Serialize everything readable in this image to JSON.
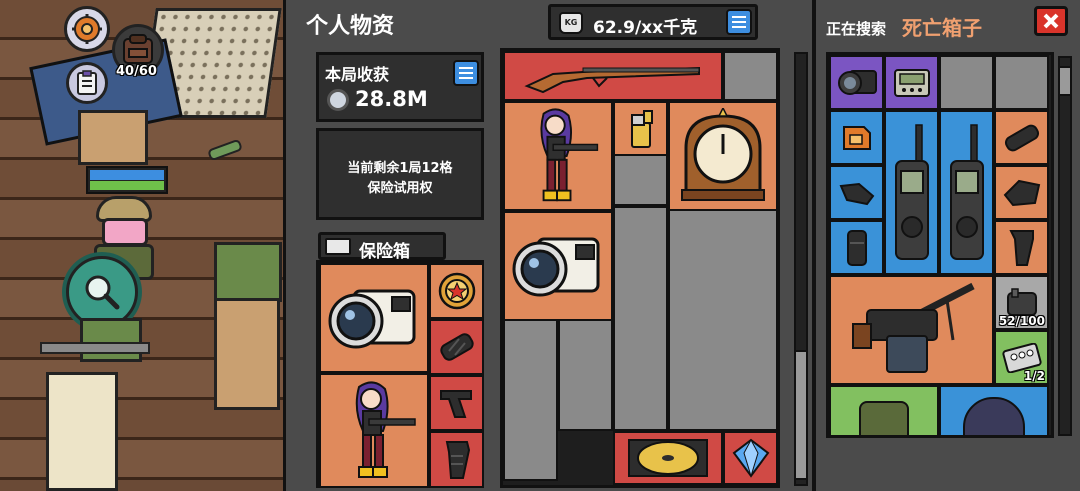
{
  "hud": {
    "carry_text": "40/60"
  },
  "personal": {
    "title": "个人物资",
    "weight_text": "62.9/xx千克",
    "kg_label": "KG",
    "earnings_title": "本局收获",
    "earnings_value": "28.8M",
    "insurance_note_line1": "当前剩余1局12格",
    "insurance_note_line2": "保险试用权",
    "safebox_title": "保险箱"
  },
  "search": {
    "label": "正在搜索",
    "target": "死亡箱子",
    "count_1": "52/100",
    "count_2": "1/2"
  },
  "colors": {
    "rarity_gray": "#8a8a8a",
    "rarity_orange": "#e08a5c",
    "rarity_red": "#d04a45",
    "rarity_blue": "#3a92d8",
    "rarity_purple": "#7b55c2",
    "rarity_green": "#82c060",
    "accent_blue": "#3d8ee0",
    "title_orange": "#f0a070",
    "close_red": "#d9342b"
  },
  "icons": [
    "settings-gear-icon",
    "backpack-icon",
    "clipboard-icon",
    "magnifier-icon",
    "list-icon",
    "close-icon",
    "rifle-icon",
    "lighter-icon",
    "mantel-clock-icon",
    "camcorder-icon",
    "medal-icon",
    "grip-icon",
    "cd-case-icon",
    "diamond-icon",
    "walkie-talkie-icon",
    "pager-icon",
    "sim-card-icon",
    "machine-gun-icon",
    "pill-pack-icon",
    "anime-girl-figure-icon"
  ]
}
